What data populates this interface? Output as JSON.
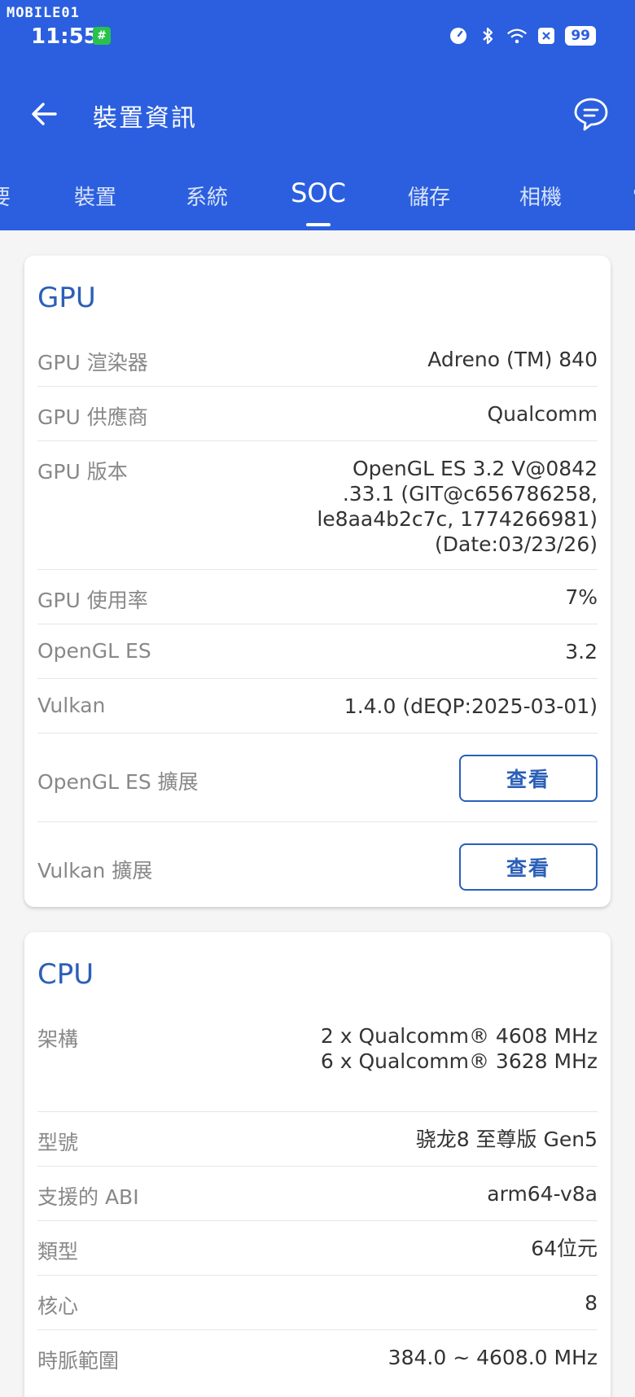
{
  "status_bar": {
    "watermark": "MOBILE01",
    "time": "11:55",
    "app_icon_glyph": "#",
    "battery": "99",
    "icons": [
      "speed-meter-icon",
      "bluetooth-icon",
      "wifi-icon",
      "x-badge-icon",
      "battery-icon"
    ]
  },
  "header": {
    "title": "裝置資訊",
    "back_icon": "arrow-left-icon",
    "feedback_icon": "chat-bubble-icon"
  },
  "tabs": [
    {
      "label": "要"
    },
    {
      "label": "裝置"
    },
    {
      "label": "系統"
    },
    {
      "label": "SOC"
    },
    {
      "label": "儲存"
    },
    {
      "label": "相機"
    },
    {
      "label": "電"
    }
  ],
  "active_tab": "SOC",
  "gpu": {
    "title": "GPU",
    "rows": [
      {
        "label": "GPU 渲染器",
        "value": "Adreno (TM) 840"
      },
      {
        "label": "GPU 供應商",
        "value": "Qualcomm"
      },
      {
        "label": "GPU 版本",
        "value_lines": [
          "OpenGL ES 3.2 V@0842",
          ".33.1 (GIT@c656786258,",
          "le8aa4b2c7c, 1774266981)",
          "(Date:03/23/26)"
        ]
      },
      {
        "label": "GPU 使用率",
        "value": "7%"
      },
      {
        "label": "OpenGL ES",
        "value": "3.2"
      },
      {
        "label": "Vulkan",
        "value": "1.4.0 (dEQP:2025-03-01)"
      },
      {
        "label": "OpenGL ES 擴展",
        "button": "查看"
      },
      {
        "label": "Vulkan 擴展",
        "button": "查看"
      }
    ]
  },
  "cpu": {
    "title": "CPU",
    "rows": [
      {
        "label": "架構",
        "value_lines": [
          "2 x Qualcomm® 4608 MHz",
          "6 x Qualcomm® 3628 MHz"
        ]
      },
      {
        "label": "型號",
        "value": "骁龙8 至尊版 Gen5"
      },
      {
        "label": "支援的 ABI",
        "value": "arm64-v8a"
      },
      {
        "label": "類型",
        "value": "64位元"
      },
      {
        "label": "核心",
        "value": "8"
      },
      {
        "label": "時脈範圍",
        "value": "384.0 ~ 4608.0 MHz"
      }
    ]
  },
  "colors": {
    "app_bar": "#2b5fdf",
    "section_title": "#2b5fb8",
    "label_gray": "#888888"
  }
}
